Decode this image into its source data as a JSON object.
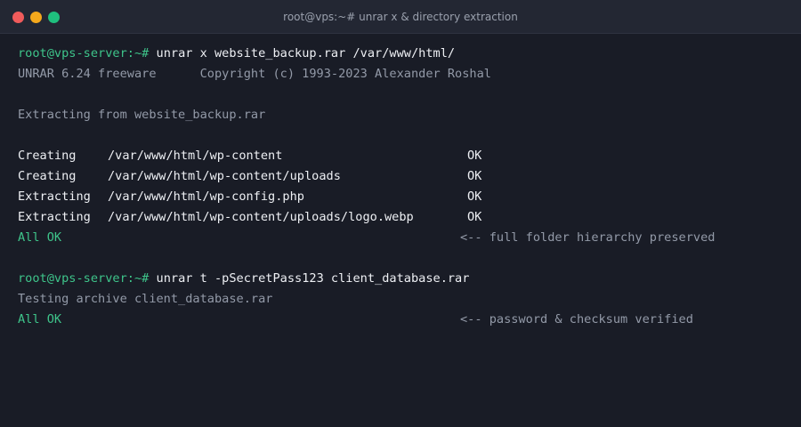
{
  "window": {
    "title": "root@vps:~# unrar x & directory extraction",
    "colors": {
      "background": "#191c26",
      "titlebar": "#232733",
      "prompt": "#3ec48a",
      "text": "#eef0f4",
      "muted": "#939aa8",
      "close": "#f05b5b",
      "minimize": "#f4a81c",
      "maximize": "#1fbf7e"
    }
  },
  "terminal": {
    "cmd1": {
      "prompt": "root@vps-server:~#",
      "command": " unrar x website_backup.rar /var/www/html/"
    },
    "banner": {
      "name": "UNRAR 6.24 freeware",
      "copyright": "Copyright (c) 1993-2023 Alexander Roshal"
    },
    "extracting_from": "Extracting from website_backup.rar",
    "entries": [
      {
        "op": "Creating",
        "path": "/var/www/html/wp-content",
        "status": "OK"
      },
      {
        "op": "Creating",
        "path": "/var/www/html/wp-content/uploads",
        "status": "OK"
      },
      {
        "op": "Extracting",
        "path": "/var/www/html/wp-config.php",
        "status": "OK"
      },
      {
        "op": "Extracting",
        "path": "/var/www/html/wp-content/uploads/logo.webp",
        "status": "OK"
      }
    ],
    "result1": {
      "status": "All OK",
      "note": "<-- full folder hierarchy preserved"
    },
    "cmd2": {
      "prompt": "root@vps-server:~#",
      "command": " unrar t -pSecretPass123 client_database.rar"
    },
    "testing": "Testing archive client_database.rar",
    "result2": {
      "status": "All OK",
      "note": "<-- password & checksum verified"
    }
  }
}
